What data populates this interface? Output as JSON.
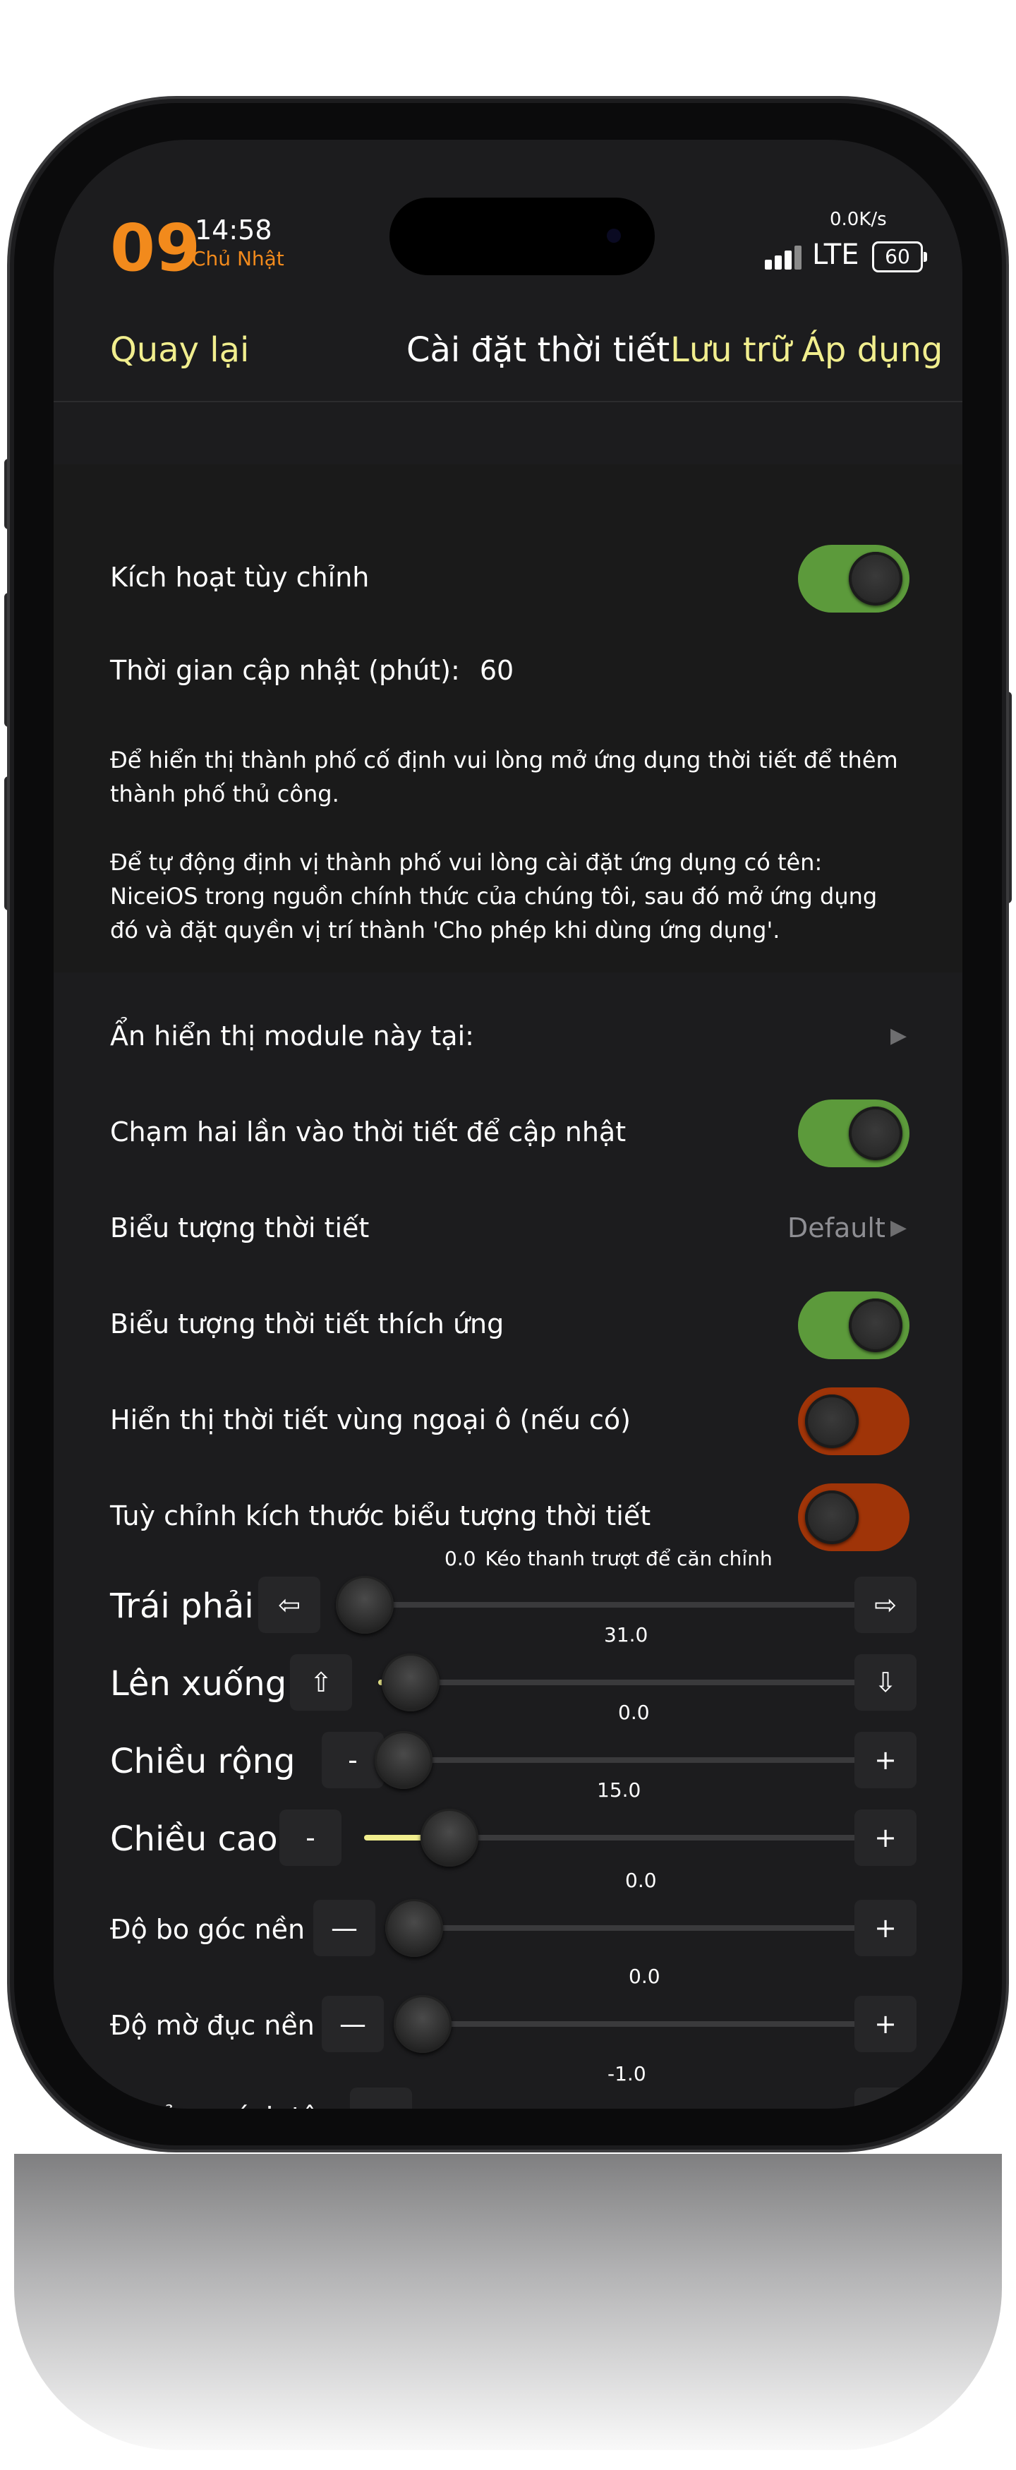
{
  "status_bar": {
    "day": "09",
    "time": "14:58",
    "weekday": "Chủ Nhật",
    "net_speed": "0.0K/s",
    "network": "LTE",
    "battery": "60"
  },
  "nav": {
    "back": "Quay lại",
    "title": "Cài đặt thời tiết",
    "save": "Lưu trữ",
    "apply": "Áp dụng"
  },
  "settings": {
    "enable_custom": {
      "label": "Kích hoạt tùy chỉnh",
      "on": true
    },
    "update_interval": {
      "label": "Thời gian cập nhật (phút):",
      "value": "60"
    },
    "note_city": "Để hiển thị thành phố cố định vui lòng mở ứng dụng thời tiết để thêm thành phố thủ công.",
    "note_locate": "Để tự động định vị thành phố vui lòng cài đặt ứng dụng có tên: NiceiOS trong nguồn chính thức của chúng tôi, sau đó mở ứng dụng đó và đặt quyền vị trí thành 'Cho phép khi dùng ứng dụng'.",
    "hide_module": {
      "label": "Ẩn hiển thị module này tại:"
    },
    "double_tap": {
      "label": "Chạm hai lần vào thời tiết để cập nhật",
      "on": true
    },
    "weather_icon": {
      "label": "Biểu tượng thời tiết",
      "value": "Default"
    },
    "adaptive_icon": {
      "label": "Biểu tượng thời tiết thích ứng",
      "on": true
    },
    "suburb_weather": {
      "label": "Hiển thị thời tiết vùng ngoại ô (nếu có)",
      "on": false
    },
    "custom_icon_size": {
      "label": "Tuỳ chỉnh kích thước biểu tượng thời tiết",
      "on": false
    }
  },
  "sliders": {
    "horizontal": {
      "label": "Trái phải",
      "value": "0.0",
      "hint": "Kéo thanh trượt để căn chỉnh",
      "dec": "⇦",
      "inc": "⇨"
    },
    "vertical": {
      "label": "Lên xuống",
      "value": "31.0",
      "dec": "⇧",
      "inc": "⇩"
    },
    "width": {
      "label": "Chiều rộng",
      "value": "0.0",
      "dec": "-",
      "inc": "+"
    },
    "height": {
      "label": "Chiều cao",
      "value": "15.0",
      "dec": "-",
      "inc": "+"
    },
    "corner_radius": {
      "label": "Độ bo góc nền",
      "value": "0.0",
      "dec": "—",
      "inc": "+"
    },
    "bg_opacity": {
      "label": "Độ mờ đục nền",
      "value": "0.0",
      "dec": "—",
      "inc": "+"
    },
    "center_distance": {
      "label": "Khoảng cách tâm",
      "value": "-1.0",
      "dec": "—",
      "inc": "+"
    }
  },
  "colors": {
    "accent": "#f1ee8e",
    "toggle_on": "#5c9a3b",
    "toggle_off": "#9f3408",
    "day_orange": "#f28a1c"
  },
  "icons": [
    "chevron-right-icon",
    "arrow-left-icon",
    "arrow-right-icon",
    "arrow-up-icon",
    "arrow-down-icon"
  ]
}
